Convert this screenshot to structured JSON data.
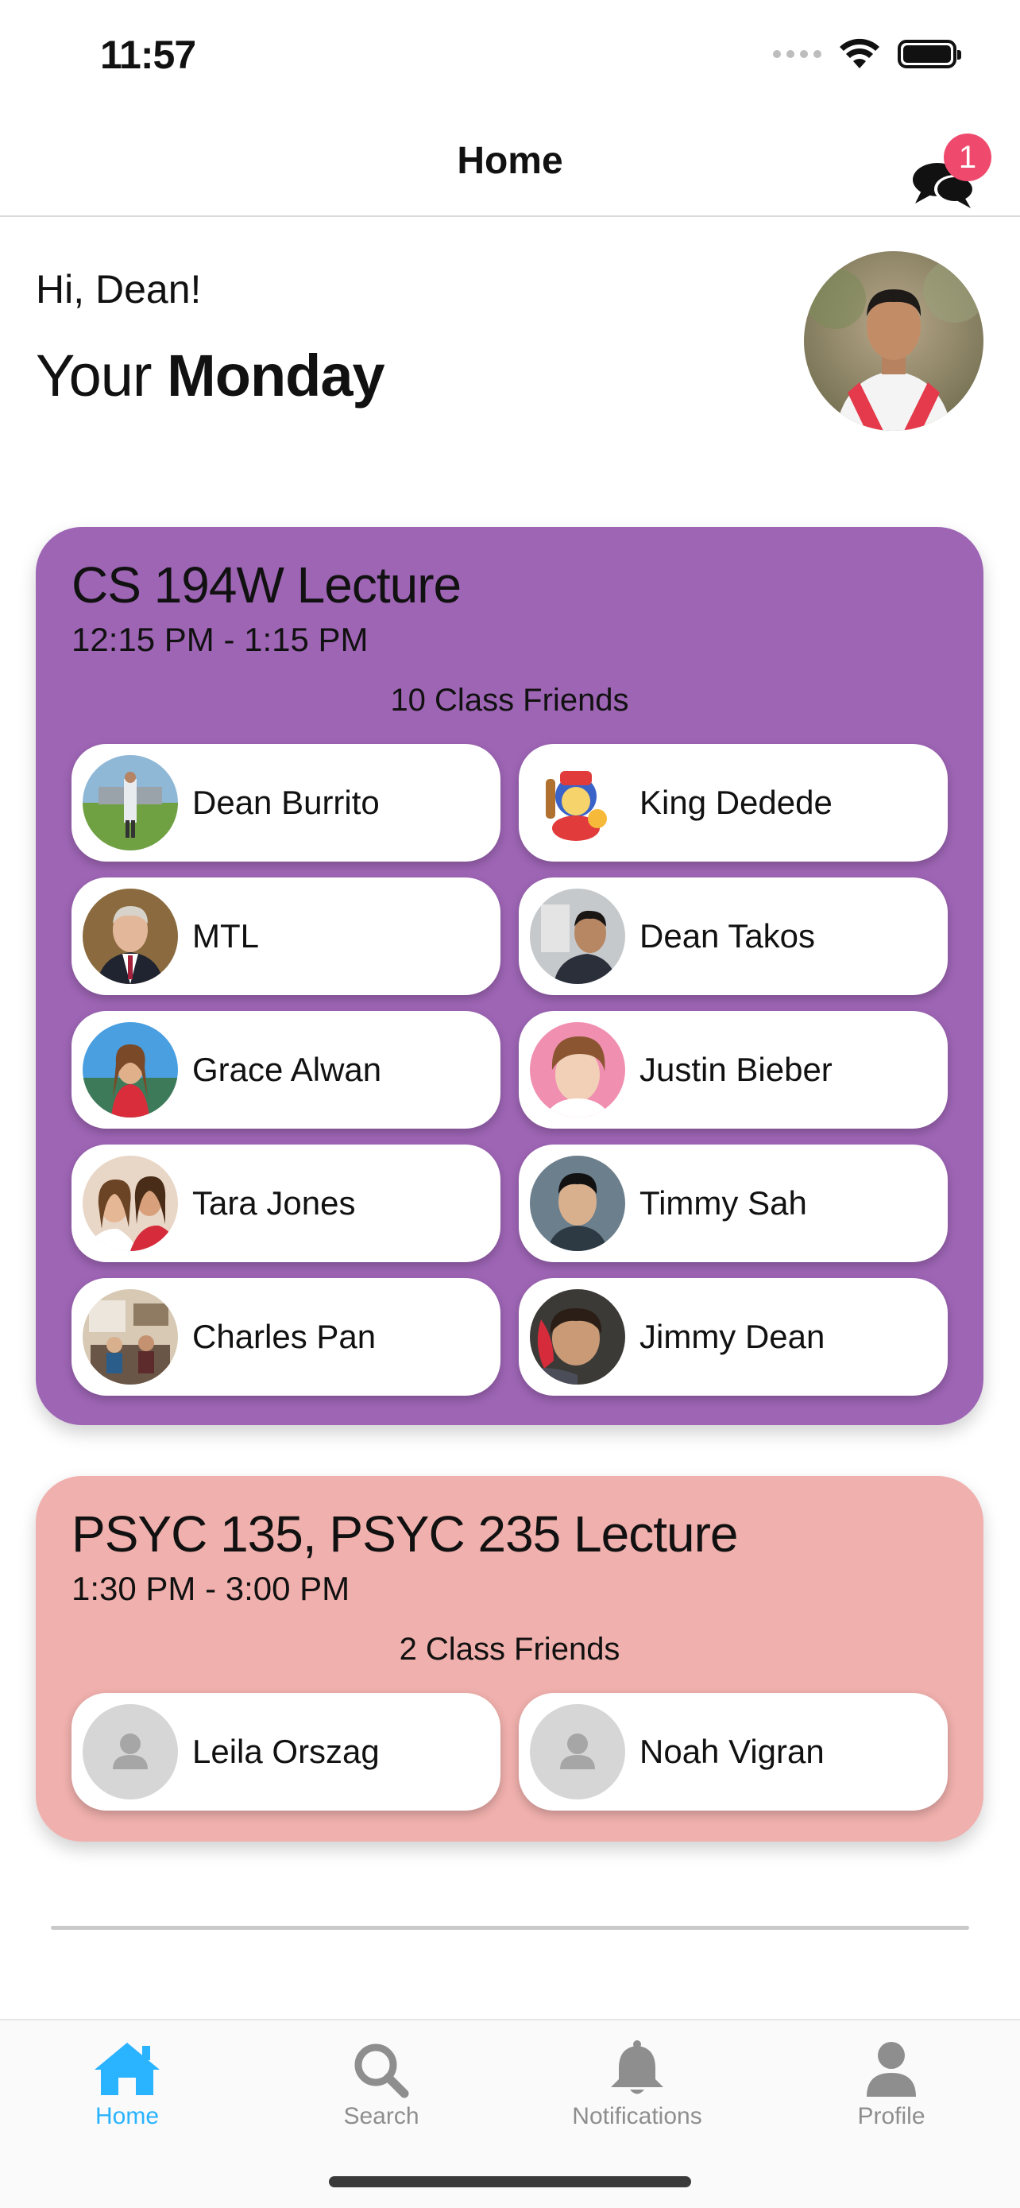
{
  "status_bar": {
    "time": "11:57"
  },
  "nav": {
    "title": "Home",
    "chat_badge_count": "1"
  },
  "header": {
    "greeting": "Hi, Dean!",
    "your_label": "Your",
    "day": "Monday"
  },
  "classes": [
    {
      "title": "CS 194W Lecture",
      "time": "12:15 PM - 1:15 PM",
      "friend_count_label": "10 Class Friends",
      "color": "#9e65b5",
      "friends": [
        {
          "name": "Dean Burrito"
        },
        {
          "name": "King Dedede"
        },
        {
          "name": "MTL"
        },
        {
          "name": "Dean Takos"
        },
        {
          "name": "Grace Alwan"
        },
        {
          "name": "Justin Bieber"
        },
        {
          "name": "Tara Jones"
        },
        {
          "name": "Timmy Sah"
        },
        {
          "name": "Charles Pan"
        },
        {
          "name": "Jimmy Dean"
        }
      ]
    },
    {
      "title": "PSYC 135, PSYC 235 Lecture",
      "time": "1:30 PM - 3:00 PM",
      "friend_count_label": "2 Class Friends",
      "color": "#f0b0ad",
      "friends": [
        {
          "name": "Leila Orszag"
        },
        {
          "name": "Noah Vigran"
        }
      ]
    }
  ],
  "tabs": [
    {
      "label": "Home",
      "icon": "house-icon",
      "active": true
    },
    {
      "label": "Search",
      "icon": "magnifier-icon",
      "active": false
    },
    {
      "label": "Notifications",
      "icon": "bell-icon",
      "active": false
    },
    {
      "label": "Profile",
      "icon": "person-icon",
      "active": false
    }
  ],
  "colors": {
    "accent": "#2ab3ff",
    "badge": "#ef4a6d",
    "tab_inactive": "#8e8e8e"
  }
}
